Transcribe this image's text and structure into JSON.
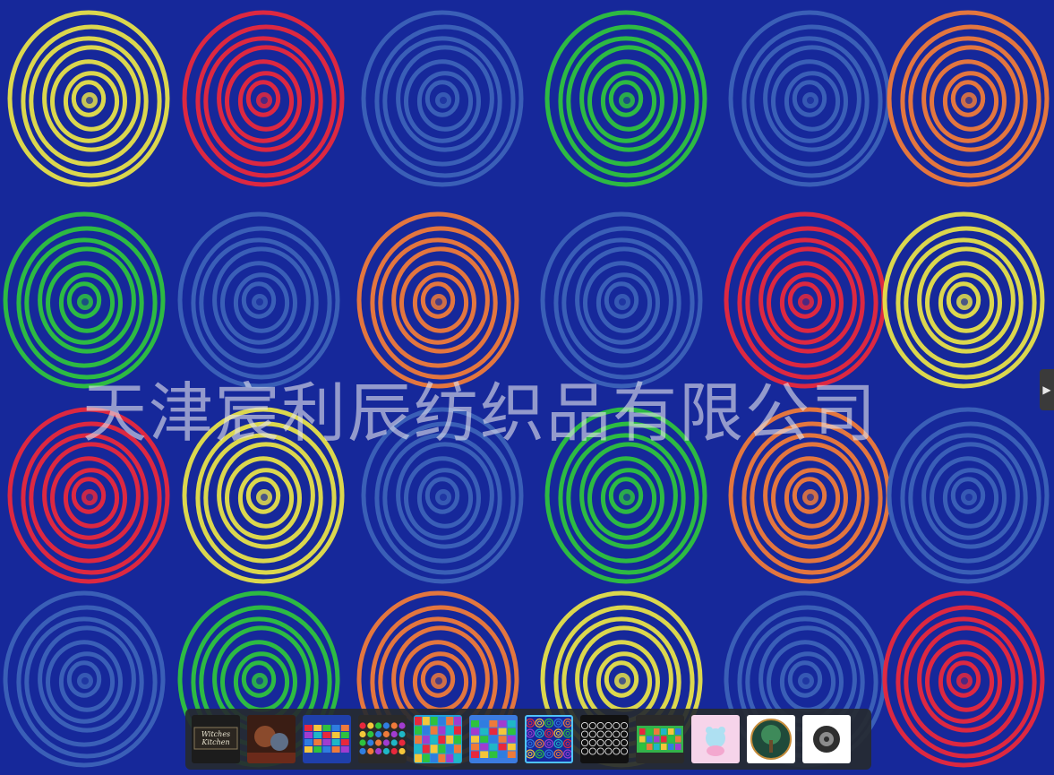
{
  "viewer": {
    "watermark": "天津宸利辰纺织品有限公司",
    "next_label": "▶",
    "colors": {
      "background": "#16289a",
      "yellow": "#e6e04a",
      "red": "#e8283c",
      "blue": "#3c62b8",
      "green": "#2ec23e",
      "orange": "#ee7a3a"
    },
    "pattern_rows": [
      [
        "yellow",
        "red",
        "blue",
        "green",
        "blue",
        "orange"
      ],
      [
        "green",
        "blue",
        "orange",
        "blue",
        "red",
        "yellow"
      ],
      [
        "red",
        "yellow",
        "blue",
        "green",
        "orange",
        "blue"
      ],
      [
        "blue",
        "green",
        "orange",
        "yellow",
        "blue",
        "red"
      ]
    ]
  },
  "thumbnails": [
    {
      "name": "witches-kitchen",
      "caption": "Witches Kitchen",
      "active": false
    },
    {
      "name": "fantasy-art",
      "caption": "",
      "active": false
    },
    {
      "name": "color-squares",
      "caption": "",
      "active": false
    },
    {
      "name": "dot-grid",
      "caption": "",
      "active": false
    },
    {
      "name": "alphabet-grid",
      "caption": "",
      "active": false
    },
    {
      "name": "color-blocks",
      "caption": "",
      "active": false
    },
    {
      "name": "spiral-rug",
      "caption": "",
      "active": true
    },
    {
      "name": "black-circles",
      "caption": "",
      "active": false
    },
    {
      "name": "green-border-rug",
      "caption": "",
      "active": false
    },
    {
      "name": "pink-bear",
      "caption": "",
      "active": false
    },
    {
      "name": "tree-of-life",
      "caption": "",
      "active": false
    },
    {
      "name": "tire-icon",
      "caption": "",
      "active": false
    }
  ]
}
